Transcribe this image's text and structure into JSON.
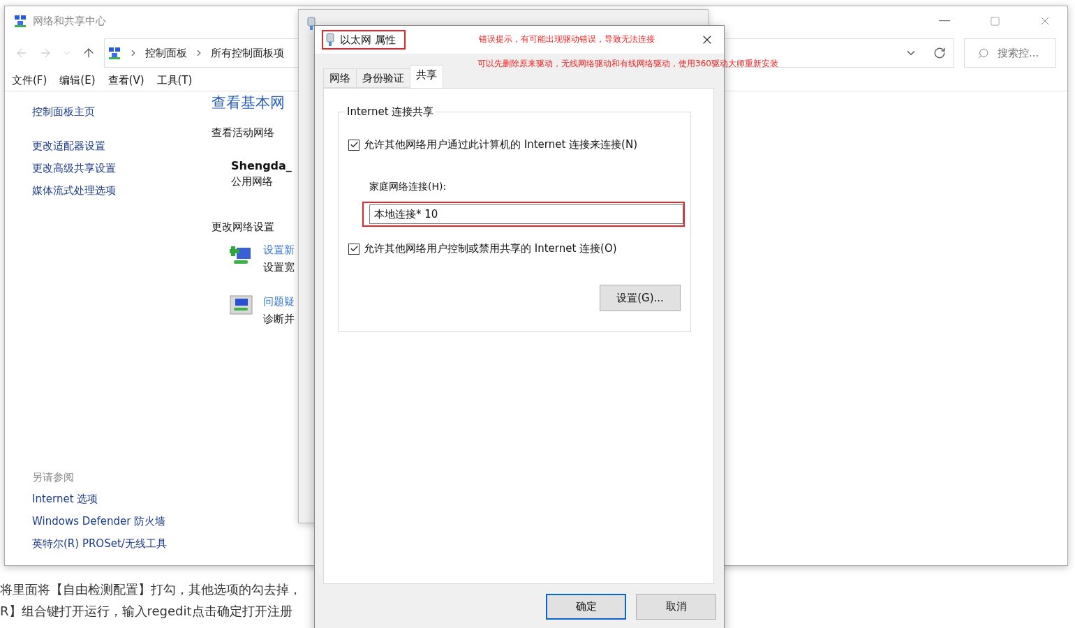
{
  "background_article": {
    "lines": [
      "将里面将【自由检测配置】打勾，其他选项的勾去掉，",
      "R】组合键打开运行，输入regedit点击确定打开注册"
    ]
  },
  "main_window": {
    "title": "网络和共享中心",
    "breadcrumb": [
      "控制面板",
      "所有控制面板项"
    ],
    "search": {
      "placeholder": "搜索控..."
    },
    "menu": [
      "文件(F)",
      "编辑(E)",
      "查看(V)",
      "工具(T)"
    ],
    "sidebar": {
      "links": [
        "控制面板主页",
        "更改适配器设置",
        "更改高级共享设置",
        "媒体流式处理选项"
      ],
      "see_also_heading": "另请参阅",
      "see_also": [
        "Internet 选项",
        "Windows Defender 防火墙",
        "英特尔(R) PROSet/无线工具"
      ]
    },
    "content": {
      "title": "查看基本网",
      "active_heading": "查看活动网络",
      "network_name": "Shengda_",
      "network_type": "公用网络",
      "change_heading": "更改网络设置",
      "tasks": [
        {
          "kind": "add",
          "link": "设置新",
          "description": "设置宽"
        },
        {
          "kind": "troubleshoot",
          "link": "问题疑",
          "description": "诊断并"
        }
      ]
    }
  },
  "properties_dialog": {
    "title": "以太网 属性",
    "tabs": [
      {
        "label": "网络",
        "selected": false
      },
      {
        "label": "身份验证",
        "selected": false
      },
      {
        "label": "共享",
        "selected": true
      }
    ],
    "group_title": "Internet 连接共享",
    "allow_connect": {
      "label": "允许其他网络用户通过此计算机的 Internet 连接来连接(N)",
      "checked": true
    },
    "home_network": {
      "label": "家庭网络连接(H):",
      "value": "本地连接* 10"
    },
    "allow_control": {
      "label": "允许其他网络用户控制或禁用共享的 Internet 连接(O)",
      "checked": true
    },
    "settings_button": "设置(G)...",
    "buttons": [
      {
        "label": "确定",
        "default": true
      },
      {
        "label": "取消",
        "default": false
      }
    ]
  },
  "annotations": [
    "错误提示，有可能出现驱动错误，导致无法连接",
    "可以先删除原来驱动，无线网络驱动和有线网络驱动，使用360驱动大师重新安装"
  ]
}
